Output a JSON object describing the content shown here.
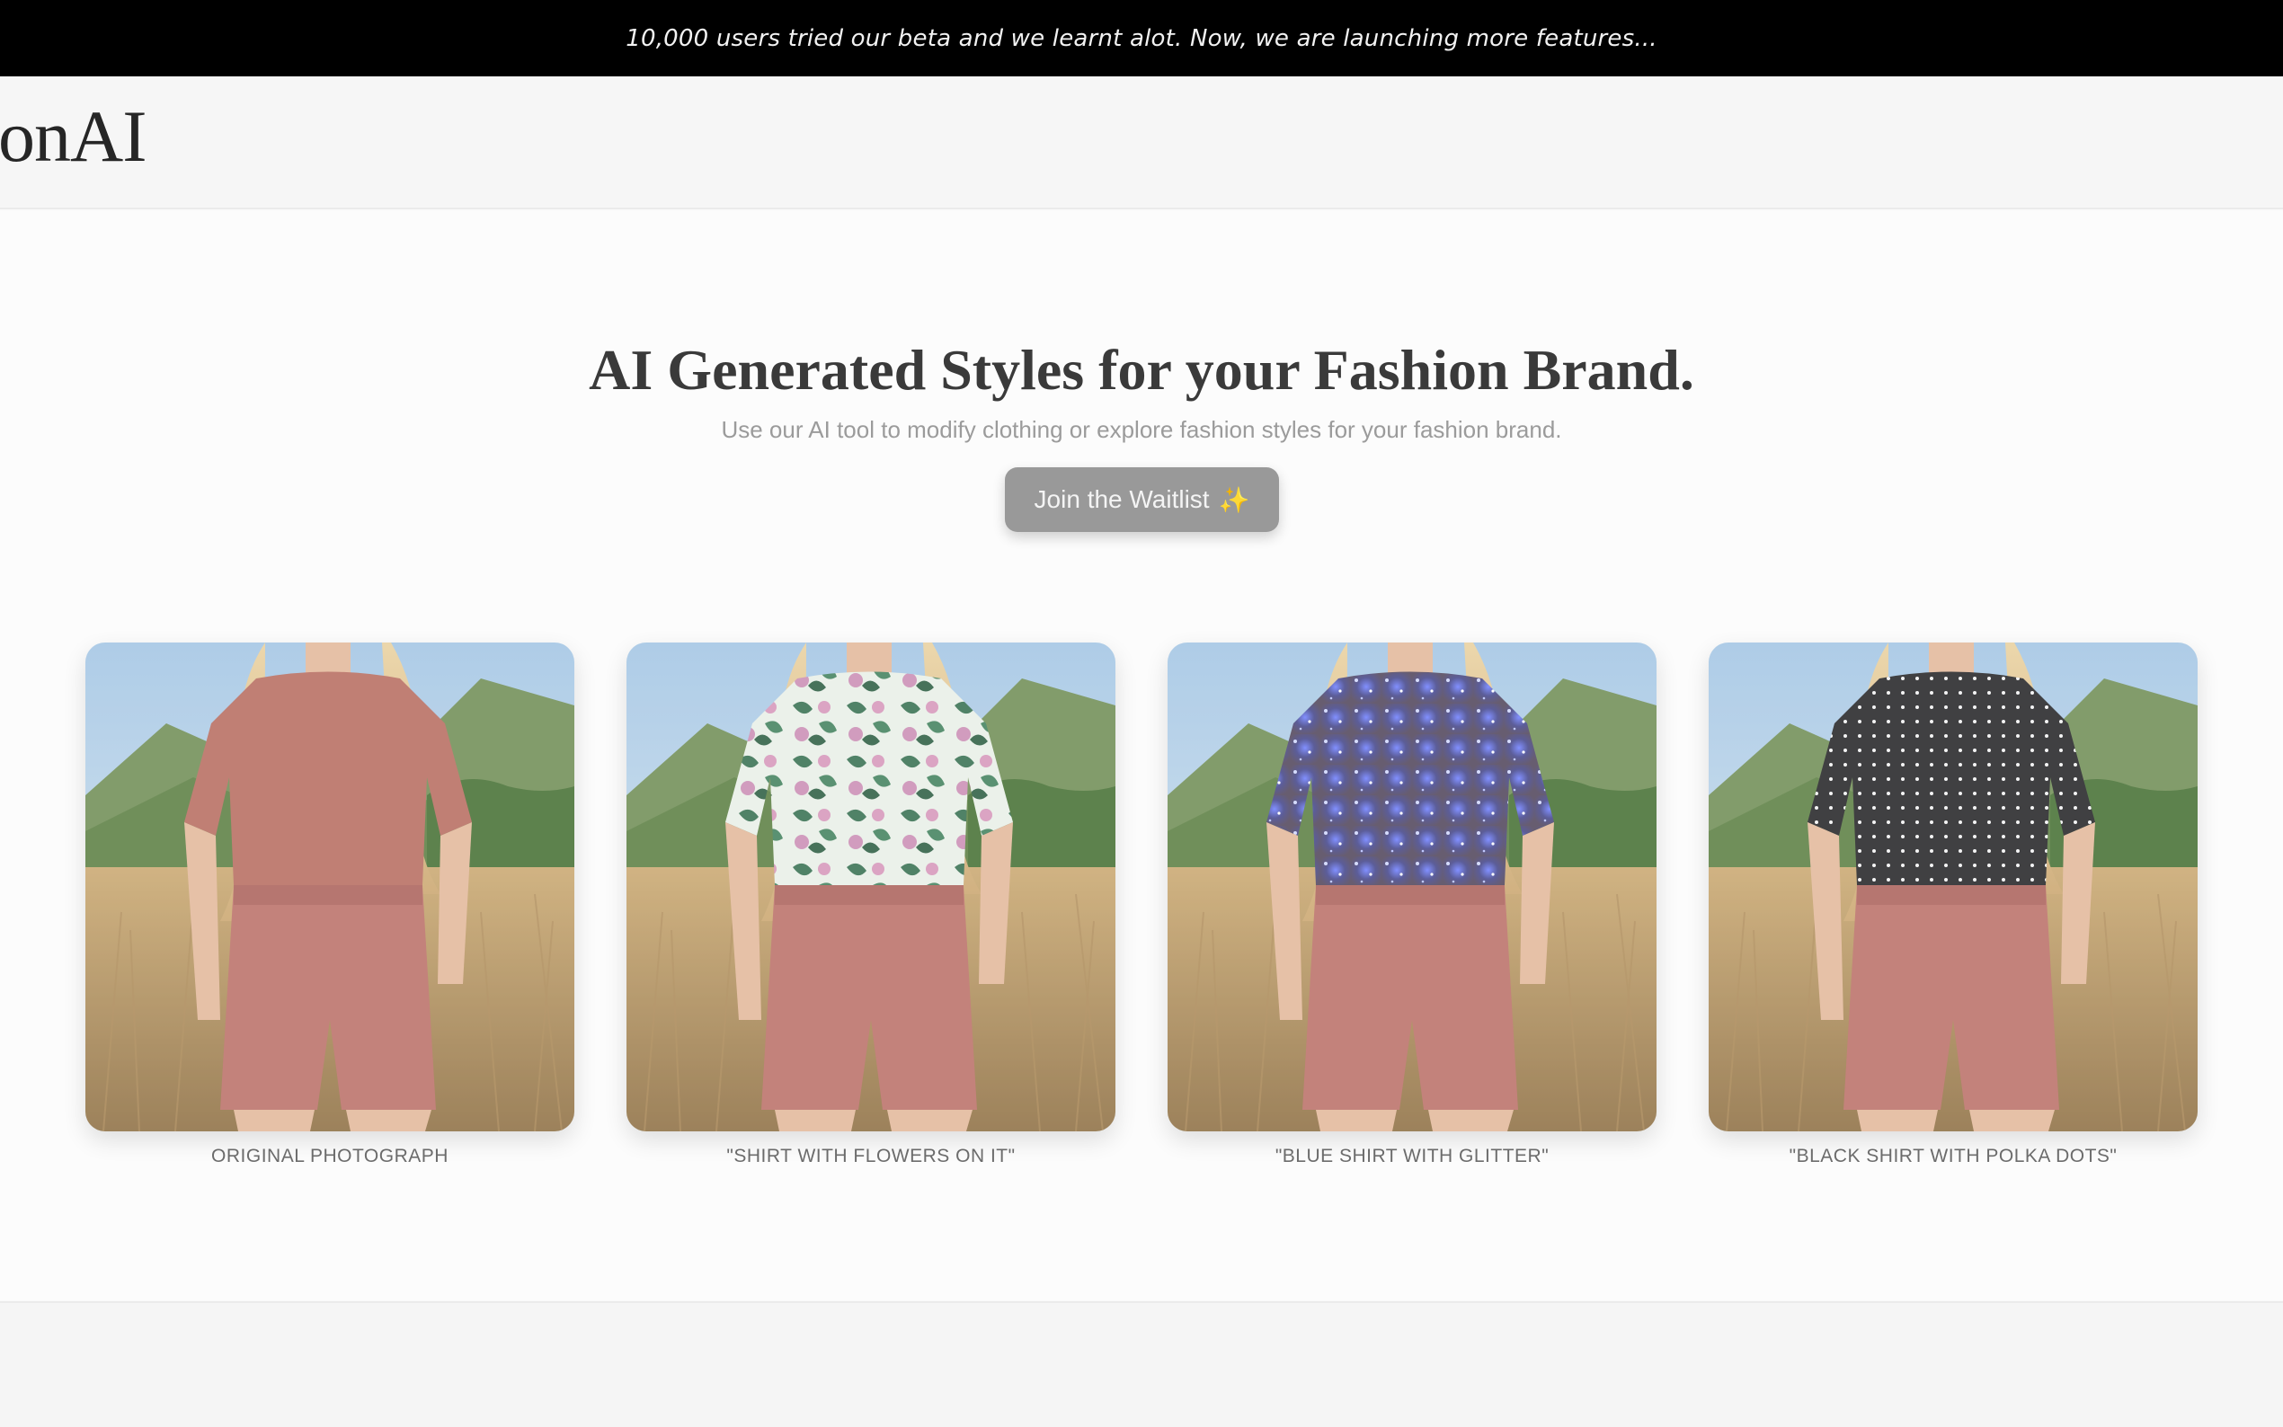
{
  "announcement": {
    "text": "10,000 users tried our beta and we learnt alot. Now, we are launching more features..."
  },
  "nav": {
    "logo_text": "onAI"
  },
  "hero": {
    "title": "AI Generated Styles for your Fashion Brand.",
    "subtitle": "Use our AI tool to modify clothing or explore fashion styles for your fashion brand.",
    "cta_label": "Join the Waitlist",
    "cta_icon": "sparkles-icon"
  },
  "gallery": [
    {
      "caption": "ORIGINAL PHOTOGRAPH",
      "shirt": "plain-rust",
      "shirt_color": "#b4675a"
    },
    {
      "caption": "\"SHIRT WITH FLOWERS ON IT\"",
      "shirt": "floral",
      "shirt_color": "#2f6a4a"
    },
    {
      "caption": "\"BLUE SHIRT WITH GLITTER\"",
      "shirt": "glitter",
      "shirt_color": "#4b4f8e"
    },
    {
      "caption": "\"BLACK SHIRT WITH POLKA DOTS\"",
      "shirt": "polka",
      "shirt_color": "#1c1c1e"
    }
  ],
  "colors": {
    "announcement_bg": "#000000",
    "cta_bg": "#999999",
    "shorts": "#b86a62"
  }
}
